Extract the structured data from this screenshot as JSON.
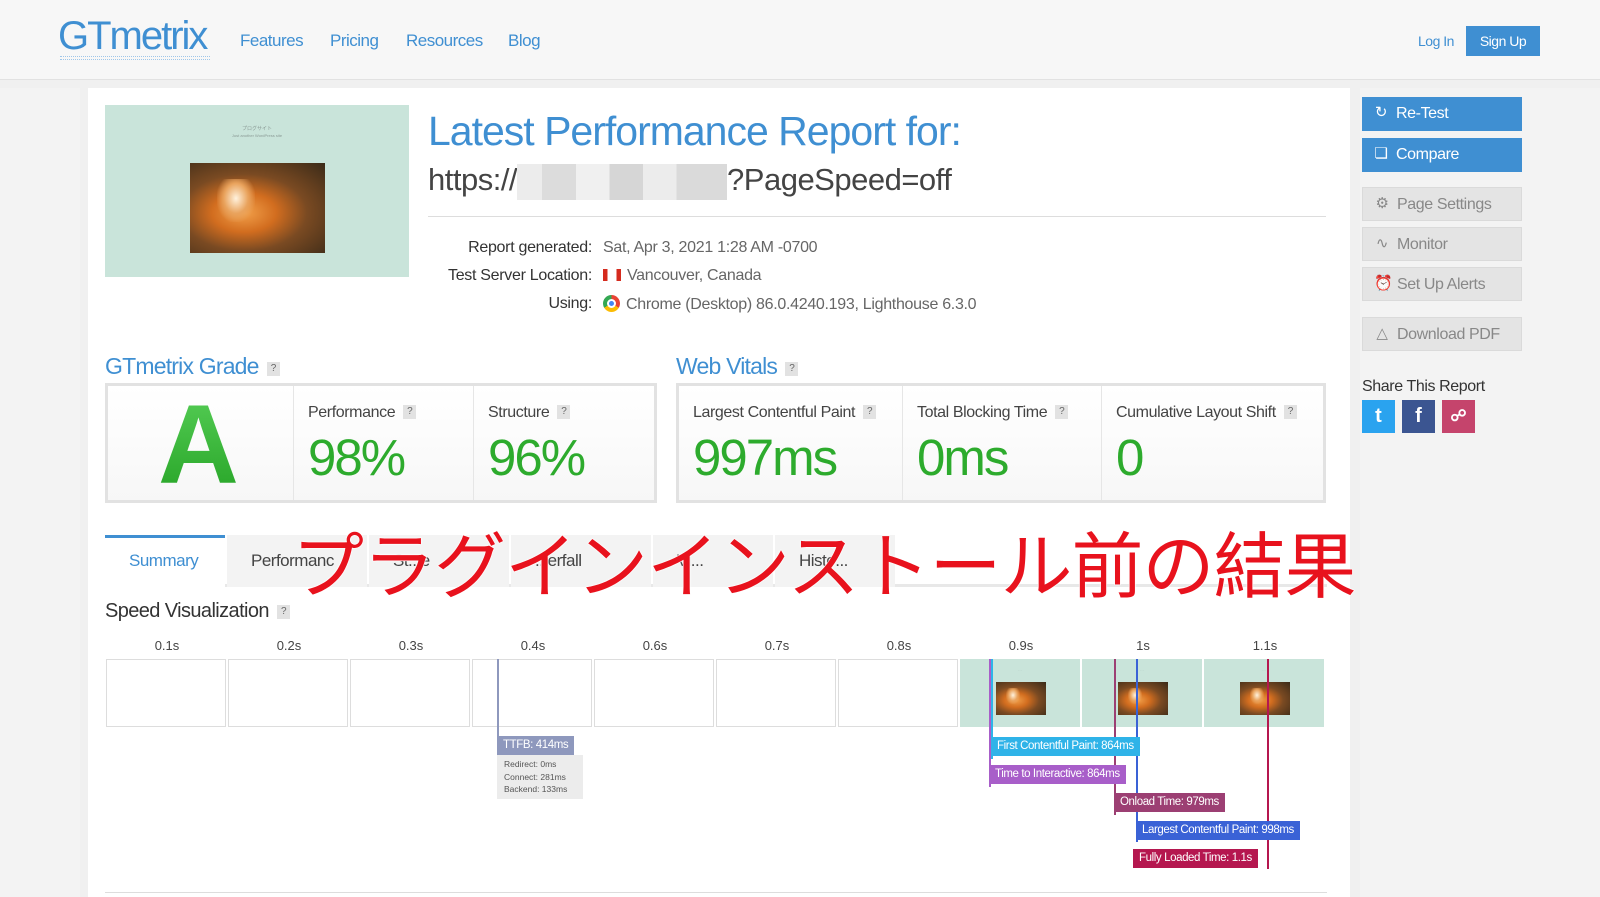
{
  "header": {
    "logo": "GTmetrix",
    "nav": [
      "Features",
      "Pricing",
      "Resources",
      "Blog"
    ],
    "login": "Log In",
    "signup": "Sign Up"
  },
  "report": {
    "title": "Latest Performance Report for:",
    "url_prefix": "https://",
    "url_suffix": "?PageSpeed=off",
    "thumb_title": "プログサイト",
    "thumb_subtitle": "Just another WordPress site",
    "meta": [
      {
        "label": "Report generated:",
        "value": "Sat, Apr 3, 2021 1:28 AM -0700",
        "icon": ""
      },
      {
        "label": "Test Server Location:",
        "value": "Vancouver, Canada",
        "icon": "canada-flag-icon"
      },
      {
        "label": "Using:",
        "value": "Chrome (Desktop) 86.0.4240.193, Lighthouse 6.3.0",
        "icon": "chrome-icon"
      }
    ]
  },
  "grade": {
    "title": "GTmetrix Grade",
    "letter": "A",
    "performance_label": "Performance",
    "performance": "98%",
    "structure_label": "Structure",
    "structure": "96%"
  },
  "vitals": {
    "title": "Web Vitals",
    "lcp_label": "Largest Contentful Paint",
    "lcp": "997ms",
    "tbt_label": "Total Blocking Time",
    "tbt": "0ms",
    "cls_label": "Cumulative Layout Shift",
    "cls": "0"
  },
  "tabs": [
    "Summary",
    "Performanc",
    "St...e",
    "...erfall",
    "Vi...",
    "Histo..."
  ],
  "overlay_text": "プラグインインストール前の結果",
  "speed": {
    "title": "Speed Visualization",
    "ticks": [
      "0.1s",
      "0.2s",
      "0.3s",
      "0.4s",
      "0.6s",
      "0.7s",
      "0.8s",
      "0.9s",
      "1s",
      "1.1s"
    ],
    "ttfb": {
      "label": "TTFB: 414ms",
      "redirect": "Redirect: 0ms",
      "connect": "Connect: 281ms",
      "backend": "Backend: 133ms"
    },
    "markers": [
      {
        "label": "First Contentful Paint: 864ms",
        "color": "#2fb3e8"
      },
      {
        "label": "Time to Interactive: 864ms",
        "color": "#a85ec9"
      },
      {
        "label": "Onload Time: 979ms",
        "color": "#9c3f73"
      },
      {
        "label": "Largest Contentful Paint: 998ms",
        "color": "#3a62d6"
      },
      {
        "label": "Fully Loaded Time: 1.1s",
        "color": "#b5174f"
      }
    ]
  },
  "sidebar": {
    "retest": "Re-Test",
    "compare": "Compare",
    "page_settings": "Page Settings",
    "monitor": "Monitor",
    "alerts": "Set Up Alerts",
    "pdf": "Download PDF",
    "share_title": "Share This Report"
  },
  "colors": {
    "brand": "#3f8fd2",
    "grade_green": "#2dab2d",
    "overlay_red": "#e8121d"
  }
}
